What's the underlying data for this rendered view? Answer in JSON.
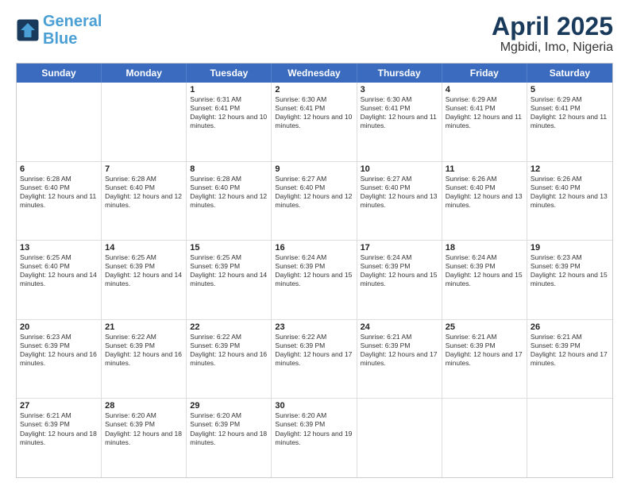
{
  "header": {
    "logo_line1": "General",
    "logo_line2": "Blue",
    "title": "April 2025",
    "subtitle": "Mgbidi, Imo, Nigeria"
  },
  "calendar": {
    "days_of_week": [
      "Sunday",
      "Monday",
      "Tuesday",
      "Wednesday",
      "Thursday",
      "Friday",
      "Saturday"
    ],
    "rows": [
      [
        {
          "day": "",
          "info": ""
        },
        {
          "day": "",
          "info": ""
        },
        {
          "day": "1",
          "info": "Sunrise: 6:31 AM\nSunset: 6:41 PM\nDaylight: 12 hours and 10 minutes."
        },
        {
          "day": "2",
          "info": "Sunrise: 6:30 AM\nSunset: 6:41 PM\nDaylight: 12 hours and 10 minutes."
        },
        {
          "day": "3",
          "info": "Sunrise: 6:30 AM\nSunset: 6:41 PM\nDaylight: 12 hours and 11 minutes."
        },
        {
          "day": "4",
          "info": "Sunrise: 6:29 AM\nSunset: 6:41 PM\nDaylight: 12 hours and 11 minutes."
        },
        {
          "day": "5",
          "info": "Sunrise: 6:29 AM\nSunset: 6:41 PM\nDaylight: 12 hours and 11 minutes."
        }
      ],
      [
        {
          "day": "6",
          "info": "Sunrise: 6:28 AM\nSunset: 6:40 PM\nDaylight: 12 hours and 11 minutes."
        },
        {
          "day": "7",
          "info": "Sunrise: 6:28 AM\nSunset: 6:40 PM\nDaylight: 12 hours and 12 minutes."
        },
        {
          "day": "8",
          "info": "Sunrise: 6:28 AM\nSunset: 6:40 PM\nDaylight: 12 hours and 12 minutes."
        },
        {
          "day": "9",
          "info": "Sunrise: 6:27 AM\nSunset: 6:40 PM\nDaylight: 12 hours and 12 minutes."
        },
        {
          "day": "10",
          "info": "Sunrise: 6:27 AM\nSunset: 6:40 PM\nDaylight: 12 hours and 13 minutes."
        },
        {
          "day": "11",
          "info": "Sunrise: 6:26 AM\nSunset: 6:40 PM\nDaylight: 12 hours and 13 minutes."
        },
        {
          "day": "12",
          "info": "Sunrise: 6:26 AM\nSunset: 6:40 PM\nDaylight: 12 hours and 13 minutes."
        }
      ],
      [
        {
          "day": "13",
          "info": "Sunrise: 6:25 AM\nSunset: 6:40 PM\nDaylight: 12 hours and 14 minutes."
        },
        {
          "day": "14",
          "info": "Sunrise: 6:25 AM\nSunset: 6:39 PM\nDaylight: 12 hours and 14 minutes."
        },
        {
          "day": "15",
          "info": "Sunrise: 6:25 AM\nSunset: 6:39 PM\nDaylight: 12 hours and 14 minutes."
        },
        {
          "day": "16",
          "info": "Sunrise: 6:24 AM\nSunset: 6:39 PM\nDaylight: 12 hours and 15 minutes."
        },
        {
          "day": "17",
          "info": "Sunrise: 6:24 AM\nSunset: 6:39 PM\nDaylight: 12 hours and 15 minutes."
        },
        {
          "day": "18",
          "info": "Sunrise: 6:24 AM\nSunset: 6:39 PM\nDaylight: 12 hours and 15 minutes."
        },
        {
          "day": "19",
          "info": "Sunrise: 6:23 AM\nSunset: 6:39 PM\nDaylight: 12 hours and 15 minutes."
        }
      ],
      [
        {
          "day": "20",
          "info": "Sunrise: 6:23 AM\nSunset: 6:39 PM\nDaylight: 12 hours and 16 minutes."
        },
        {
          "day": "21",
          "info": "Sunrise: 6:22 AM\nSunset: 6:39 PM\nDaylight: 12 hours and 16 minutes."
        },
        {
          "day": "22",
          "info": "Sunrise: 6:22 AM\nSunset: 6:39 PM\nDaylight: 12 hours and 16 minutes."
        },
        {
          "day": "23",
          "info": "Sunrise: 6:22 AM\nSunset: 6:39 PM\nDaylight: 12 hours and 17 minutes."
        },
        {
          "day": "24",
          "info": "Sunrise: 6:21 AM\nSunset: 6:39 PM\nDaylight: 12 hours and 17 minutes."
        },
        {
          "day": "25",
          "info": "Sunrise: 6:21 AM\nSunset: 6:39 PM\nDaylight: 12 hours and 17 minutes."
        },
        {
          "day": "26",
          "info": "Sunrise: 6:21 AM\nSunset: 6:39 PM\nDaylight: 12 hours and 17 minutes."
        }
      ],
      [
        {
          "day": "27",
          "info": "Sunrise: 6:21 AM\nSunset: 6:39 PM\nDaylight: 12 hours and 18 minutes."
        },
        {
          "day": "28",
          "info": "Sunrise: 6:20 AM\nSunset: 6:39 PM\nDaylight: 12 hours and 18 minutes."
        },
        {
          "day": "29",
          "info": "Sunrise: 6:20 AM\nSunset: 6:39 PM\nDaylight: 12 hours and 18 minutes."
        },
        {
          "day": "30",
          "info": "Sunrise: 6:20 AM\nSunset: 6:39 PM\nDaylight: 12 hours and 19 minutes."
        },
        {
          "day": "",
          "info": ""
        },
        {
          "day": "",
          "info": ""
        },
        {
          "day": "",
          "info": ""
        }
      ]
    ]
  }
}
